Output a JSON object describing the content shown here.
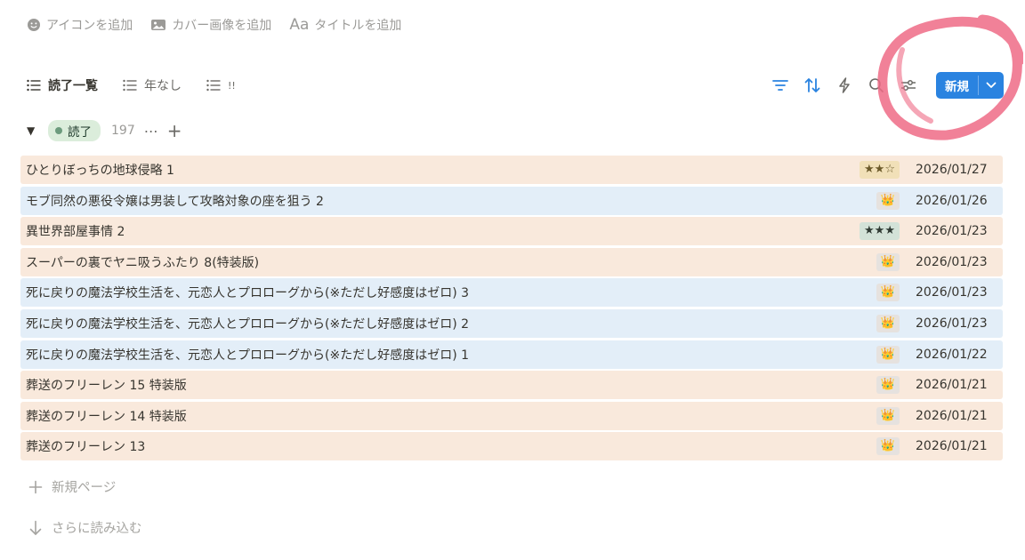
{
  "page_actions": {
    "add_icon": "アイコンを追加",
    "add_cover": "カバー画像を追加",
    "add_title": "タイトルを追加",
    "add_title_glyph": "Aa"
  },
  "views": [
    {
      "label": "読了一覧",
      "active": true
    },
    {
      "label": "年なし",
      "active": false
    },
    {
      "label": "!!",
      "active": false
    }
  ],
  "toolbar": {
    "new_label": "新規",
    "accent": "#2a83e0",
    "icons": [
      "filter-icon",
      "sort-icon",
      "automation-icon",
      "search-icon",
      "settings-icon"
    ]
  },
  "group": {
    "label": "読了",
    "count": "197",
    "more": "⋯",
    "add": "+"
  },
  "rows": [
    {
      "title": "ひとりぼっちの地球侵略 1",
      "tag": "★★☆",
      "tag_kind": "t2",
      "date": "2026/01/27",
      "color": "peach"
    },
    {
      "title": "モブ同然の悪役令嬢は男装して攻略対象の座を狙う 2",
      "tag": "👑",
      "tag_kind": "tc",
      "date": "2026/01/26",
      "color": "blue"
    },
    {
      "title": "異世界部屋事情 2",
      "tag": "★★★",
      "tag_kind": "t3",
      "date": "2026/01/23",
      "color": "peach"
    },
    {
      "title": "スーパーの裏でヤニ吸うふたり 8(特装版)",
      "tag": "👑",
      "tag_kind": "tc",
      "date": "2026/01/23",
      "color": "peach"
    },
    {
      "title": "死に戻りの魔法学校生活を、元恋人とプロローグから(※ただし好感度はゼロ) 3",
      "tag": "👑",
      "tag_kind": "tc",
      "date": "2026/01/23",
      "color": "blue"
    },
    {
      "title": "死に戻りの魔法学校生活を、元恋人とプロローグから(※ただし好感度はゼロ) 2",
      "tag": "👑",
      "tag_kind": "tc",
      "date": "2026/01/23",
      "color": "blue"
    },
    {
      "title": "死に戻りの魔法学校生活を、元恋人とプロローグから(※ただし好感度はゼロ) 1",
      "tag": "👑",
      "tag_kind": "tc",
      "date": "2026/01/22",
      "color": "blue"
    },
    {
      "title": "葬送のフリーレン 15 特装版",
      "tag": "👑",
      "tag_kind": "tc",
      "date": "2026/01/21",
      "color": "peach"
    },
    {
      "title": "葬送のフリーレン 14 特装版",
      "tag": "👑",
      "tag_kind": "tc",
      "date": "2026/01/21",
      "color": "peach"
    },
    {
      "title": "葬送のフリーレン 13",
      "tag": "👑",
      "tag_kind": "tc",
      "date": "2026/01/21",
      "color": "peach"
    }
  ],
  "footer": {
    "new_page": "新規ページ",
    "load_more": "さらに読み込む"
  }
}
